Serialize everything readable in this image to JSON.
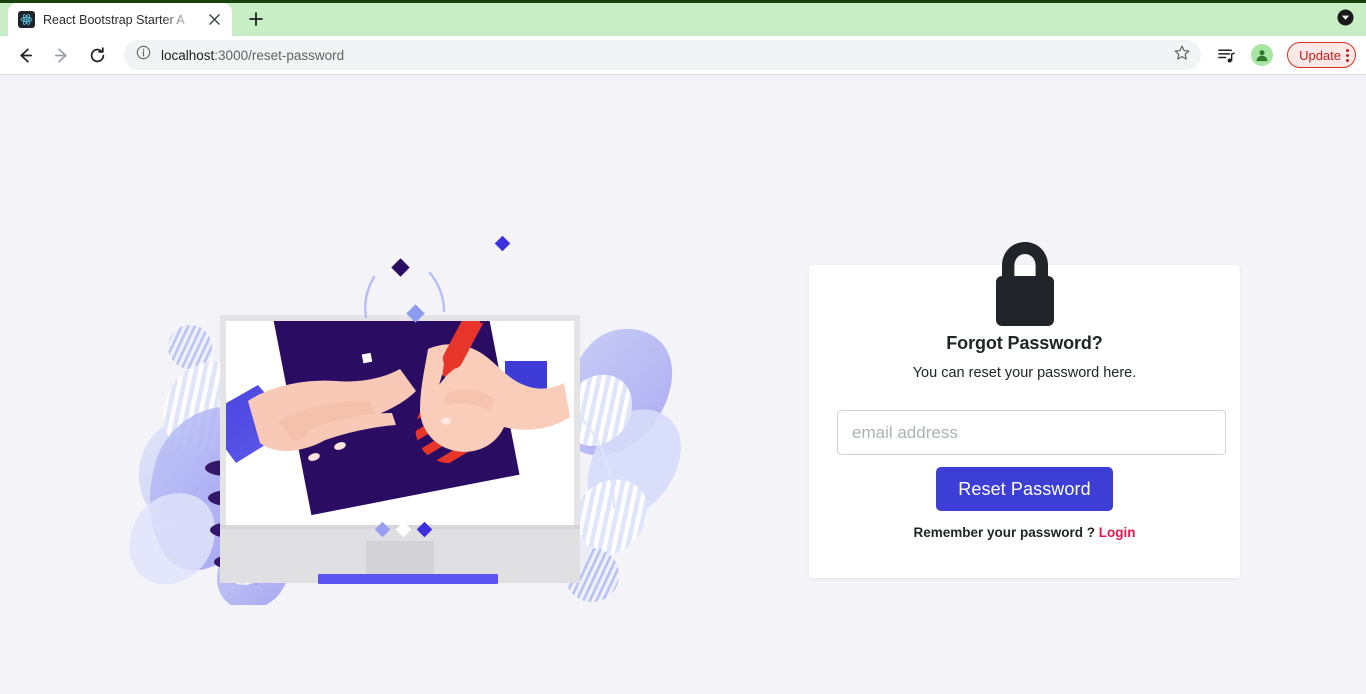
{
  "browser": {
    "tab": {
      "title": "React Bootstrap Starter A",
      "favicon": "react-logo-icon",
      "close_icon": "close-icon"
    },
    "new_tab_icon": "plus-icon",
    "tabstrip_menu_icon": "caret-down-circle-icon",
    "back_icon": "back-arrow-icon",
    "forward_icon": "forward-arrow-icon",
    "reload_icon": "reload-icon",
    "omnibox": {
      "info_icon": "site-info-icon",
      "url_host": "localhost",
      "url_path": ":3000/reset-password",
      "star_icon": "bookmark-star-icon"
    },
    "reading_list_icon": "reading-list-icon",
    "profile_icon": "profile-avatar-icon",
    "update": {
      "label": "Update",
      "menu_icon": "kebab-menu-icon"
    },
    "colors": {
      "tabstrip_bg": "#c8eec6",
      "tabstrip_border": "#17410f",
      "update_text": "#c5221f",
      "update_bg": "#fce8e6"
    }
  },
  "page": {
    "background": "#f4f4f8",
    "illustration": {
      "name": "person-drawing-on-monitor-illustration",
      "alt": "Hands with a red pen drawing on a dark tablet emerging from a desktop monitor, surrounded by blue leaf shapes"
    },
    "card": {
      "lock_icon": "padlock-icon",
      "title": "Forgot Password?",
      "subtitle": "You can reset your password here.",
      "email": {
        "placeholder": "email address",
        "value": ""
      },
      "submit_label": "Reset Password",
      "remember_text": "Remember your password ?",
      "login_link": "Login",
      "colors": {
        "button": "#3c3ed6",
        "link": "#e8174c",
        "lock": "#212529"
      }
    }
  }
}
